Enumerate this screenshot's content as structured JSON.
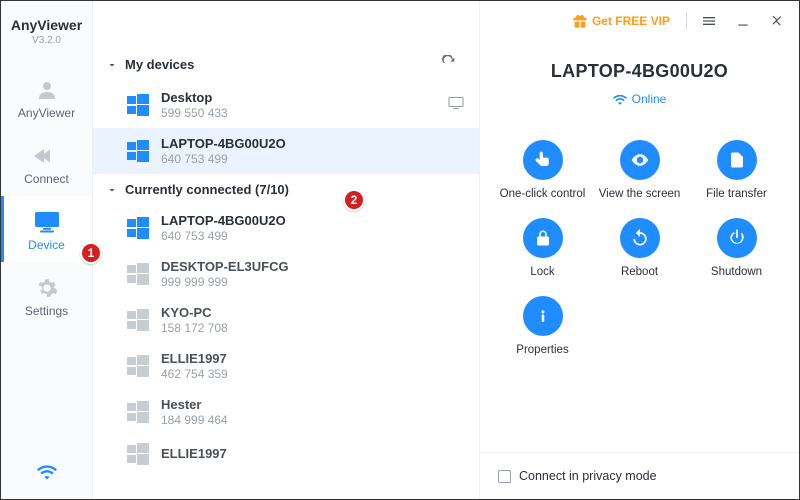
{
  "brand": {
    "name": "AnyViewer",
    "version": "V3.2.0"
  },
  "sidebar": {
    "items": [
      {
        "label": "AnyViewer"
      },
      {
        "label": "Connect"
      },
      {
        "label": "Device"
      },
      {
        "label": "Settings"
      }
    ]
  },
  "topbar": {
    "vip_label": "Get FREE VIP"
  },
  "sections": {
    "my_devices_label": "My devices",
    "connected_label": "Currently connected (7/10)"
  },
  "my_devices": [
    {
      "name": "Desktop",
      "id": "599 550 433"
    },
    {
      "name": "LAPTOP-4BG00U2O",
      "id": "640 753 499"
    }
  ],
  "connected": [
    {
      "name": "LAPTOP-4BG00U2O",
      "id": "640 753 499"
    },
    {
      "name": "DESKTOP-EL3UFCG",
      "id": "999 999 999"
    },
    {
      "name": "KYO-PC",
      "id": "158 172 708"
    },
    {
      "name": "ELLIE1997",
      "id": "462 754 359"
    },
    {
      "name": "Hester",
      "id": "184 999 464"
    },
    {
      "name": "ELLIE1997",
      "id": ""
    }
  ],
  "detail": {
    "title": "LAPTOP-4BG00U2O",
    "status": "Online",
    "actions": [
      {
        "label": "One-click control"
      },
      {
        "label": "View the screen"
      },
      {
        "label": "File transfer"
      },
      {
        "label": "Lock"
      },
      {
        "label": "Reboot"
      },
      {
        "label": "Shutdown"
      },
      {
        "label": "Properties"
      }
    ],
    "privacy_label": "Connect in privacy mode"
  },
  "annotations": {
    "b1": "1",
    "b2": "2"
  }
}
